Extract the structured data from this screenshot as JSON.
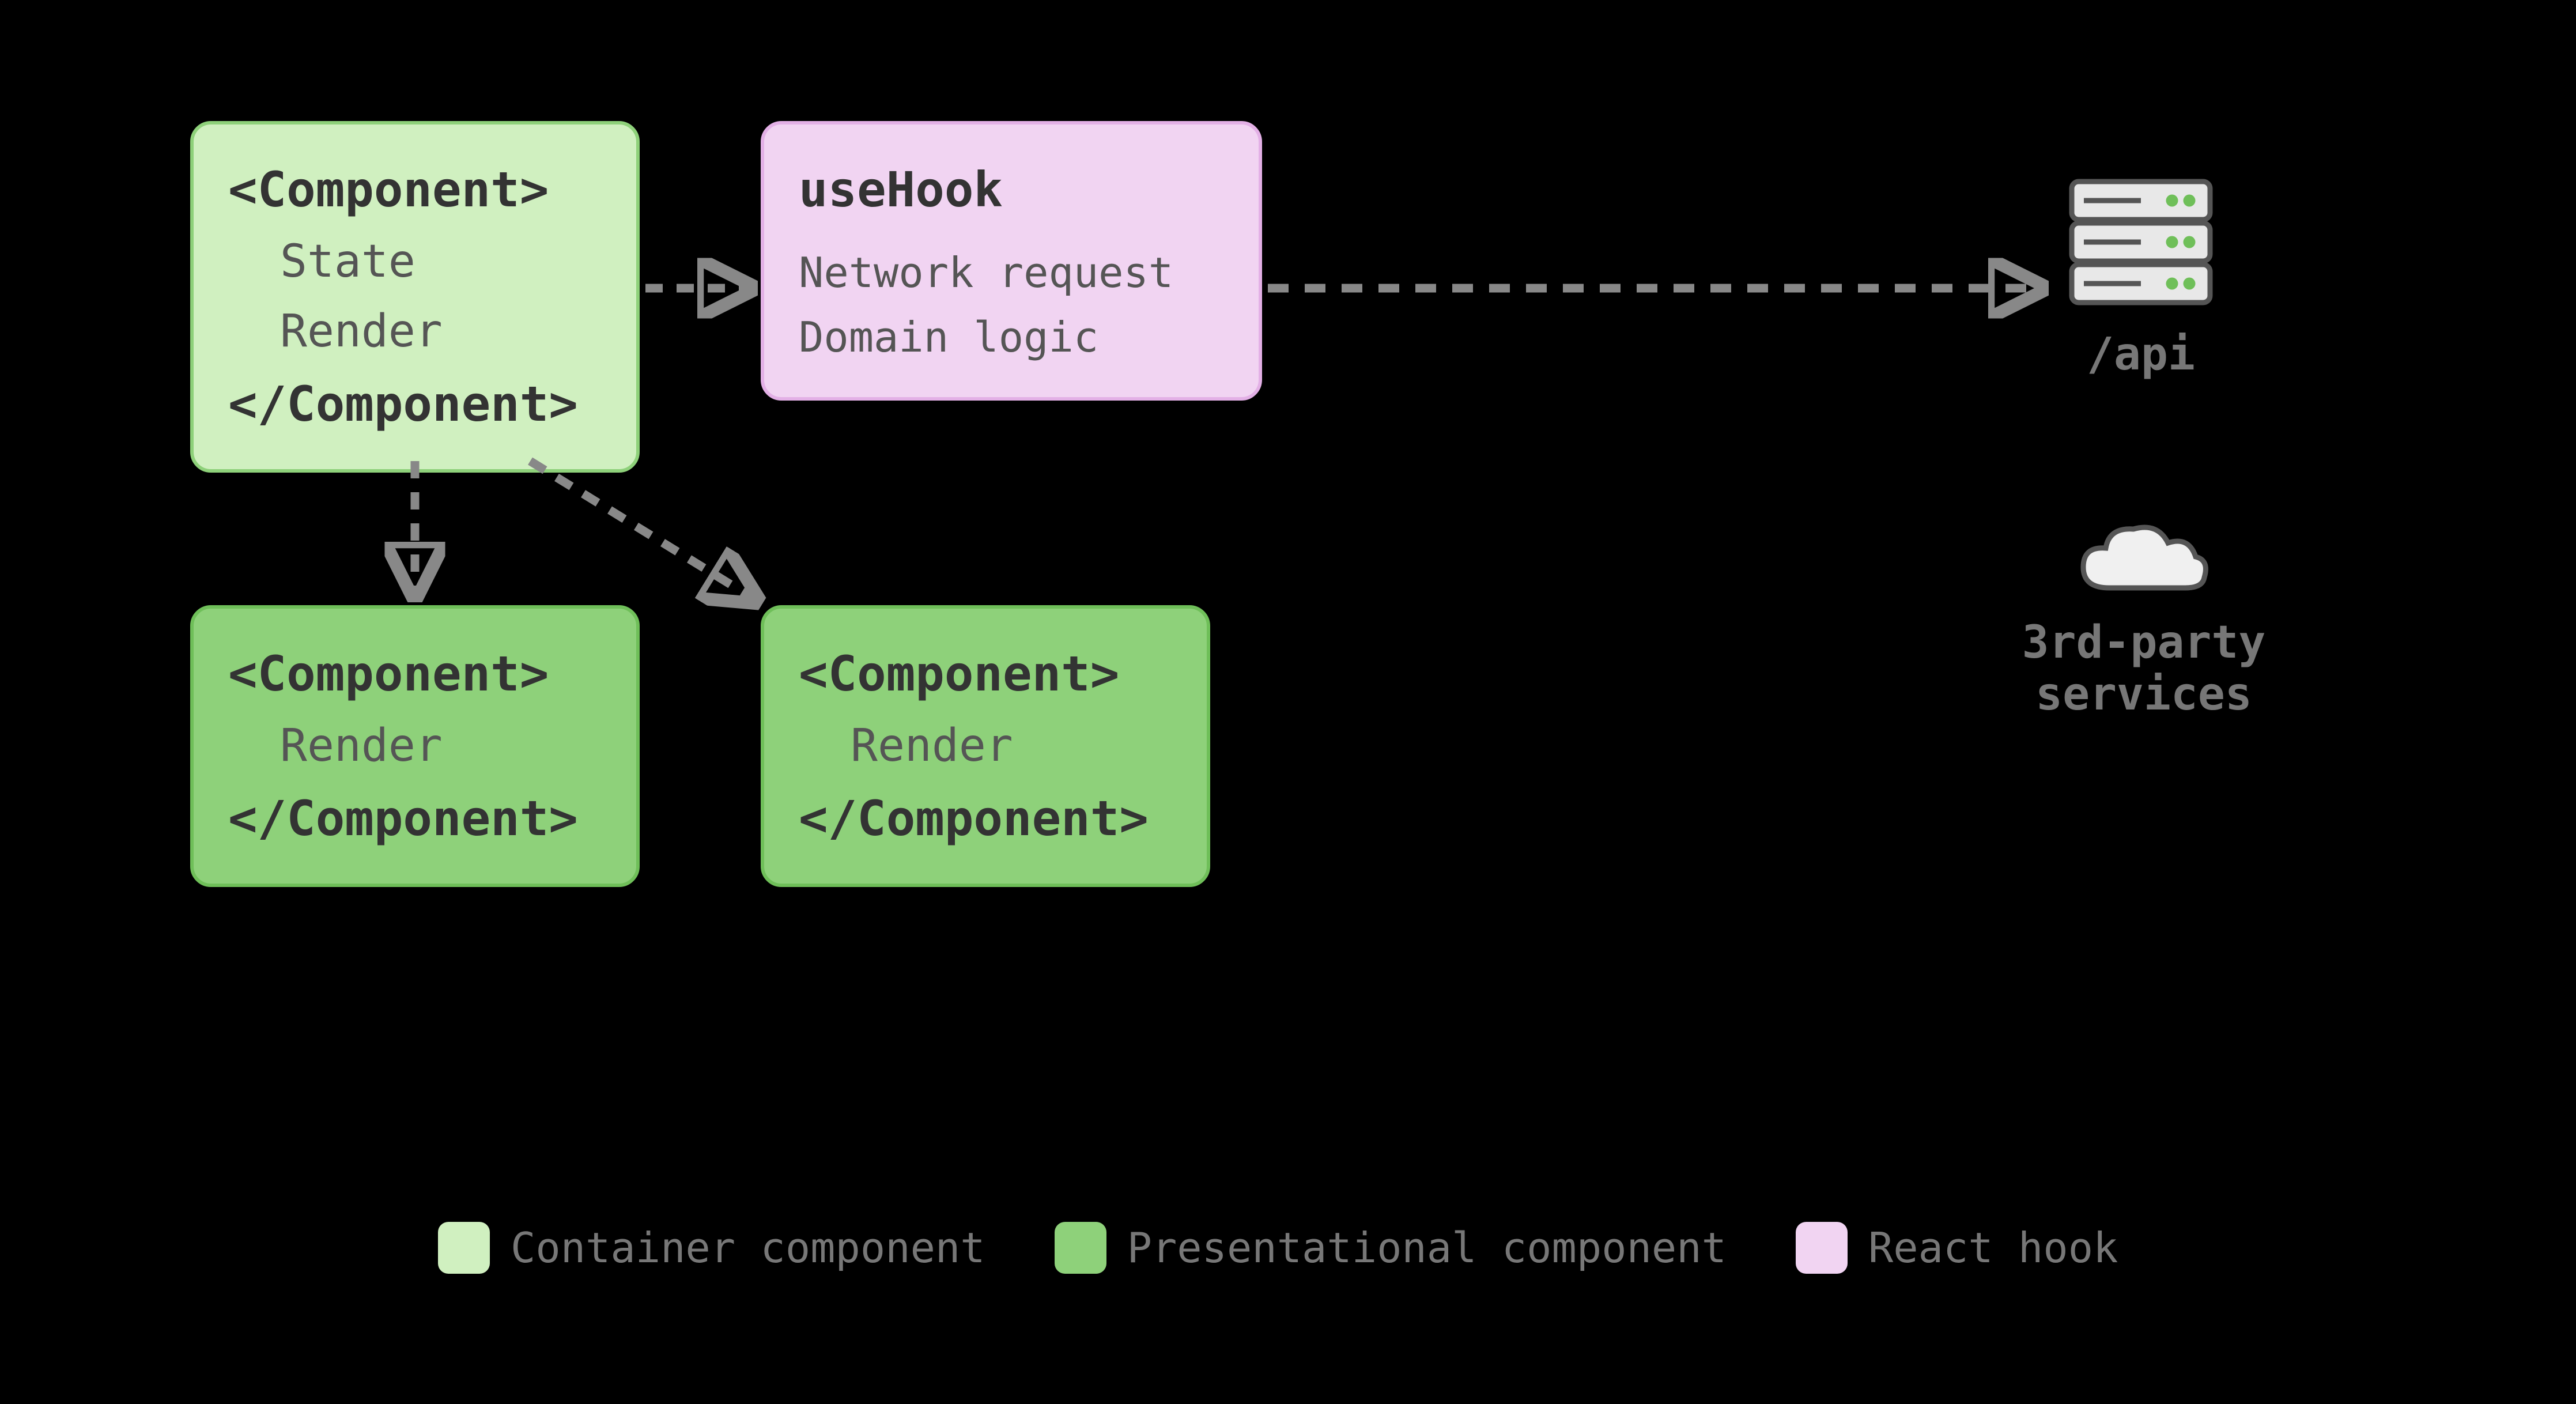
{
  "boxes": {
    "container": {
      "open": "<Component>",
      "line1": "State",
      "line2": "Render",
      "close": "</Component>"
    },
    "hook": {
      "title": "useHook",
      "line1": "Network request",
      "line2": "Domain logic"
    },
    "presentational_left": {
      "open": "<Component>",
      "line1": "Render",
      "close": "</Component>"
    },
    "presentational_right": {
      "open": "<Component>",
      "line1": "Render",
      "close": "</Component>"
    }
  },
  "external": {
    "api_label": "/api",
    "services_label_line1": "3rd-party",
    "services_label_line2": "services"
  },
  "legend": {
    "container": "Container component",
    "presentational": "Presentational component",
    "hook": "React hook"
  },
  "colors": {
    "container_bg": "#d0f0c0",
    "presentational_bg": "#8ed17a",
    "hook_bg": "#f1d4f2",
    "arrow": "#888888"
  },
  "layout": {
    "font_box_title": 84,
    "font_box_body": 78,
    "font_api": 78,
    "font_services": 78
  }
}
